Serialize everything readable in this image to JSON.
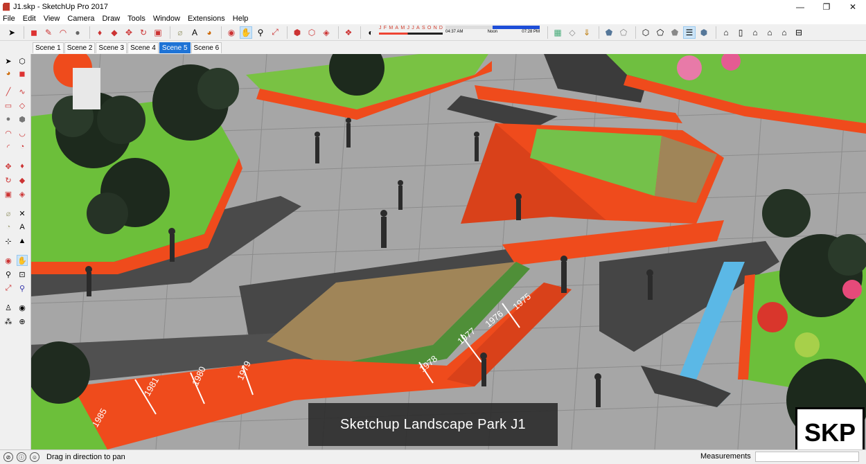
{
  "window": {
    "title": "J1.skp - SketchUp Pro 2017",
    "controls": {
      "minimize": "—",
      "maximize": "❐",
      "close": "✕"
    }
  },
  "menu": [
    "File",
    "Edit",
    "View",
    "Camera",
    "Draw",
    "Tools",
    "Window",
    "Extensions",
    "Help"
  ],
  "toolbar": {
    "months": [
      "J",
      "F",
      "M",
      "A",
      "M",
      "J",
      "J",
      "A",
      "S",
      "O",
      "N",
      "D"
    ],
    "times": [
      "04:37 AM",
      "Noon",
      "07:28 PM"
    ]
  },
  "scenes": {
    "tabs": [
      "Scene 1",
      "Scene 2",
      "Scene 3",
      "Scene 4",
      "Scene 5",
      "Scene 6"
    ],
    "active": "Scene 5"
  },
  "viewport": {
    "caption": "Sketchup Landscape Park J1",
    "logo": "SKP",
    "year_labels": [
      "1985",
      "1981",
      "1980",
      "1979",
      "1978",
      "1977",
      "1976",
      "1975"
    ]
  },
  "status": {
    "hint": "Drag in direction to pan",
    "measurements_label": "Measurements",
    "measurements_value": ""
  },
  "colors": {
    "accent": "#1e73d6",
    "planter_orange": "#ef4b1c",
    "grass": "#6cbf3a",
    "paving": "#a9a9a9",
    "deck": "#a08558",
    "water": "#5bb8e6"
  }
}
